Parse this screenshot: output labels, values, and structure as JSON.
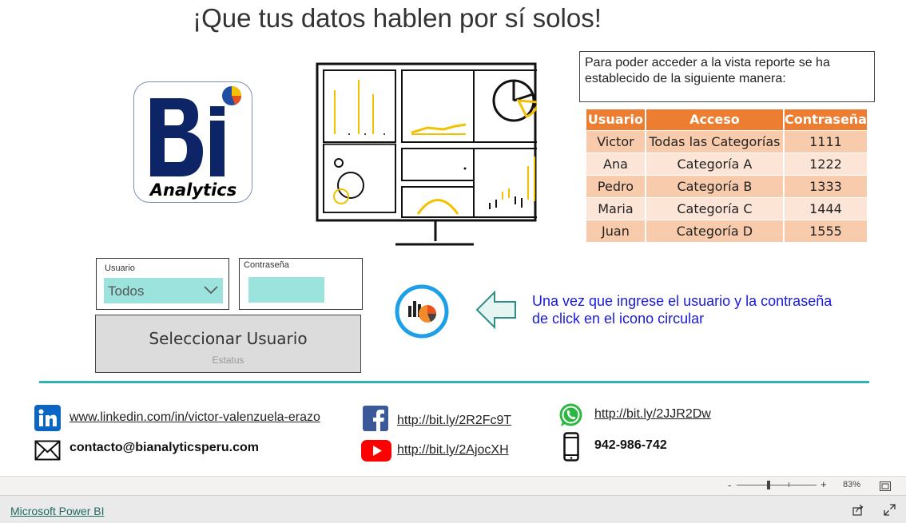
{
  "header": {
    "title": "¡Que tus datos hablen por sí solos!"
  },
  "logo": {
    "letters": "BI",
    "tagline": "Analytics"
  },
  "info": {
    "text": "Para poder acceder a la vista reporte se ha establecido de la siguiente manera:"
  },
  "access_table": {
    "headers": [
      "Usuario",
      "Acceso",
      "Contraseña"
    ],
    "rows": [
      [
        "Victor",
        "Todas las Categorías",
        "1111"
      ],
      [
        "Ana",
        "Categoría A",
        "1222"
      ],
      [
        "Pedro",
        "Categoría B",
        "1333"
      ],
      [
        "Maria",
        "Categoría C",
        "1444"
      ],
      [
        "Juan",
        "Categoría D",
        "1555"
      ]
    ]
  },
  "login": {
    "user_label": "Usuario",
    "user_value": "Todos",
    "password_label": "Contraseña",
    "password_value": "",
    "button_label": "Seleccionar Usuario",
    "status_label": "Estatus"
  },
  "instruction": {
    "text": "Una vez que ingrese el usuario y la contraseña de click en el icono circular"
  },
  "contacts": {
    "linkedin": "www.linkedin.com/in/victor-valenzuela-erazo",
    "email": "contacto@bianalyticsperu.com",
    "facebook": "http://bit.ly/2R2Fc9T",
    "youtube": "http://bit.ly/2AjocXH",
    "whatsapp": "http://bit.ly/2JJR2Dw",
    "phone": "942-986-742"
  },
  "footer": {
    "zoom_minus": "-",
    "zoom_plus": "+",
    "zoom_level": "83%",
    "powerbi_link": "Microsoft Power BI"
  },
  "colors": {
    "accent_teal": "#2cb5b0",
    "table_header": "#ed7d31",
    "row_dark": "#f8cbad",
    "row_light": "#fce4d6",
    "input_fill": "#9de3dd",
    "instruction_blue": "#1a1adc"
  },
  "icons": [
    "linkedin-icon",
    "email-icon",
    "facebook-icon",
    "youtube-icon",
    "whatsapp-icon",
    "phone-icon",
    "report-icon",
    "arrow-left-icon",
    "chevron-down-icon",
    "share-icon",
    "fullscreen-icon",
    "fit-page-icon"
  ]
}
